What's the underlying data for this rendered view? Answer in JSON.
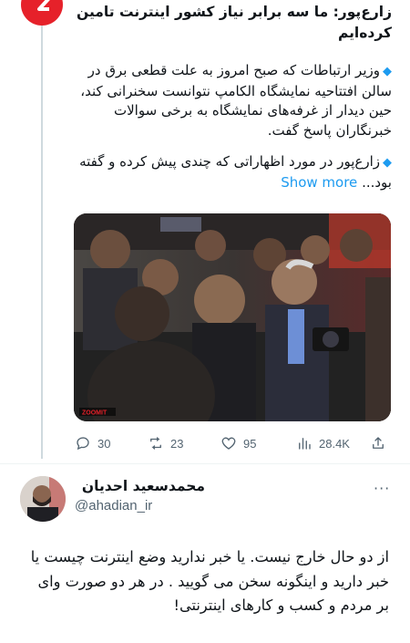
{
  "tweet1": {
    "avatar_icon": "zoomit-logo-icon",
    "title": "زارع‌پور: ما سه برابر نیاز کشور اینترنت تامین کرده‌ایم",
    "para1": "وزیر ارتباطات که صبح امروز به علت قطعی برق در سالن افتتاحیه نمایشگاه الکامپ نتوانست سخنرانی کند، حین دیدار از غرفه‌های نمایشگاه به برخی سوالات خبرنگاران پاسخ گفت.",
    "para2": "زارع‌پور در مورد اظهاراتی که چندی پیش کرده و گفته بود...",
    "show_more": "Show more",
    "photo_watermark": "ZOOMIT",
    "actions": {
      "replies": "30",
      "retweets": "23",
      "likes": "95",
      "views": "28.4K"
    }
  },
  "tweet2": {
    "name": "محمدسعید احدیان",
    "handle": "@ahadian_ir",
    "more_icon": "more-icon",
    "text": "از دو حال خارج نیست. یا خبر ندارید وضع اینترنت چیست یا خبر دارید و اینگونه سخن می گویید . در هر دو صورت وای بر مردم و کسب و کارهای اینترنتی!"
  },
  "colors": {
    "accent": "#1d9bf0",
    "brand_red": "#e6212a",
    "muted": "#536471"
  }
}
